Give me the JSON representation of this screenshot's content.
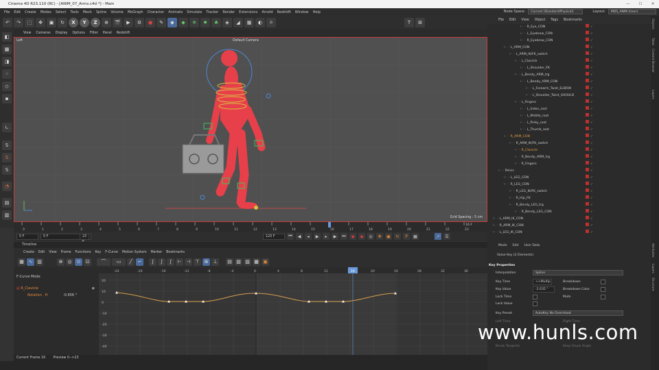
{
  "window": {
    "title": "Cinema 4D R23.110 (RC) - [ANIM_07_Arms.c4d *] - Main"
  },
  "menubar": {
    "items": [
      "File",
      "Edit",
      "Create",
      "Modes",
      "Select",
      "Tools",
      "Mesh",
      "Spline",
      "Volume",
      "MoGraph",
      "Character",
      "Animate",
      "Simulate",
      "Tracker",
      "Render",
      "Extensions",
      "Arnold",
      "Redshift",
      "Window",
      "Help"
    ],
    "node_space_label": "Node Space:",
    "node_space_value": "Current (Standard/Physical)",
    "layout_label": "Layout:",
    "layout_value": "MDS_ANIM (User)"
  },
  "viewport": {
    "menu": [
      "View",
      "Cameras",
      "Display",
      "Options",
      "Filter",
      "Panel",
      "Redshift"
    ],
    "view_name": "Left",
    "camera": "Default Camera",
    "grid_spacing": "Grid Spacing : 5 cm"
  },
  "timeline_ruler": {
    "ticks": [
      "0",
      "1",
      "2",
      "3",
      "4",
      "5",
      "6",
      "7",
      "8",
      "9",
      "10",
      "11",
      "12",
      "13",
      "14",
      "15",
      "16",
      "17",
      "18",
      "19",
      "20",
      "21",
      "22",
      "23"
    ],
    "end_label": "16 F",
    "current": 16
  },
  "playback": {
    "start": "0 F",
    "start2": "0 F",
    "end2": "23 F",
    "end": "120 F"
  },
  "timeline": {
    "title": "Timeline",
    "menu": [
      "Create",
      "Edit",
      "View",
      "Frame",
      "Functions",
      "Key",
      "F-Curve",
      "Motion System",
      "Marker",
      "Bookmarks"
    ],
    "mode": "F-Curve Mode",
    "track_name": "R_Clavicle",
    "track_param": "Rotation . H",
    "track_value": "-0.656 °",
    "frame_ticks": [
      "-24",
      "-20",
      "-16",
      "-12",
      "-8",
      "-4",
      "0",
      "4",
      "8",
      "12",
      "16",
      "20",
      "24",
      "28",
      "32",
      "36"
    ],
    "current_frame_label": "16",
    "value_ticks": [
      "20",
      "10",
      "0",
      "-10",
      "-20",
      "-30",
      "-40"
    ],
    "footer_current": "Current Frame  16",
    "footer_preview": "Preview  0-->23"
  },
  "object_manager": {
    "menu": [
      "File",
      "Edit",
      "View",
      "Object",
      "Tags",
      "Bookmarks"
    ],
    "rows": [
      {
        "name": "R_Eye_CON",
        "indent": 12
      },
      {
        "name": "L_Eyebrow_CON",
        "indent": 12
      },
      {
        "name": "R_Eyebrow_CON",
        "indent": 12
      },
      {
        "name": "L_ARM_CON",
        "indent": 6
      },
      {
        "name": "L_ARM_IK/FK_switch",
        "indent": 8
      },
      {
        "name": "L_Clavicle",
        "indent": 10
      },
      {
        "name": "L_Shoulder_FK",
        "indent": 12
      },
      {
        "name": "L_Bendy_ARM_trg",
        "indent": 10
      },
      {
        "name": "L_Bendy_ARM_CON",
        "indent": 12
      },
      {
        "name": "L_Forearm_Twist_ELBOW",
        "indent": 14
      },
      {
        "name": "L_Shoulder_Twist_SHOULD",
        "indent": 14
      },
      {
        "name": "L_Fingers",
        "indent": 10
      },
      {
        "name": "L_Index_root",
        "indent": 12
      },
      {
        "name": "L_Middle_root",
        "indent": 12
      },
      {
        "name": "L_Pinky_root",
        "indent": 12
      },
      {
        "name": "L_Thumb_root",
        "indent": 12
      },
      {
        "name": "R_ARM_CON",
        "indent": 6
      },
      {
        "name": "R_ARM_IK/FK_switch",
        "indent": 8
      },
      {
        "name": "R_Clavicle",
        "indent": 10
      },
      {
        "name": "R_Bendy_ARM_trg",
        "indent": 10
      },
      {
        "name": "R_Fingers",
        "indent": 10
      },
      {
        "name": "Pelvis",
        "indent": 4
      },
      {
        "name": "L_LEG_CON",
        "indent": 6
      },
      {
        "name": "R_LEG_CON",
        "indent": 6
      },
      {
        "name": "R_LEG_IK/FK_switch",
        "indent": 8
      },
      {
        "name": "R_Hip_FK",
        "indent": 8
      },
      {
        "name": "R_Bendy_LEG_trg",
        "indent": 8
      },
      {
        "name": "R_Bendy_LEG_CON",
        "indent": 10
      },
      {
        "name": "L_ARM_IK_CON",
        "indent": 2
      },
      {
        "name": "R_ARM_IK_CON",
        "indent": 2
      },
      {
        "name": "L_LEG_IK_CON",
        "indent": 2
      }
    ],
    "highlighted_rows": [
      "R_ARM_CON",
      "R_Clavicle"
    ]
  },
  "attributes": {
    "menu": [
      "Mode",
      "Edit",
      "User Data"
    ],
    "header": "Value Key (2 Elements)",
    "section": "Key Properties",
    "interpolation_label": "Interpolation",
    "interpolation_value": "Spline",
    "key_time_label": "Key Time",
    "key_time_value": "<<Multip",
    "breakdown_label": "Breakdown",
    "key_value_label": "Key Value",
    "key_value_value": "-2.635 °",
    "breakdown_color_label": "Breakdown Color",
    "lock_time_label": "Lock Time",
    "mute_label": "Mute",
    "lock_value_label": "Lock Value",
    "key_preset_label": "Key Preset",
    "key_preset_value": "AutoKey No Overshoot",
    "left_time_label": "Left Time",
    "right_time_label": "Right Time",
    "break_tangents_label": "Break Tangents",
    "keep_visual_angle_label": "Keep Visual Angle"
  },
  "side_tabs": [
    "Objects",
    "Takes",
    "Content Browser",
    "Layers",
    "Attributes",
    "Layers",
    "Structure"
  ],
  "watermark": "www.hunls.com",
  "colors": {
    "accent": "#4a90d9",
    "character": "#e8404a",
    "selection": "#c84040",
    "curve": "#d9a050"
  }
}
